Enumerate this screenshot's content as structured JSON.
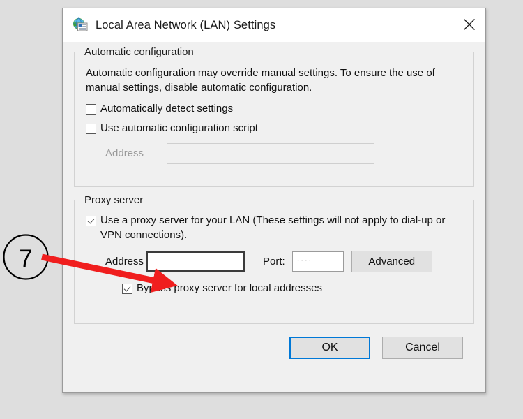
{
  "window": {
    "title": "Local Area Network (LAN) Settings",
    "icon": "globe-settings-icon",
    "close_icon": "close-icon"
  },
  "auto_config": {
    "group_title": "Automatic configuration",
    "description": "Automatic configuration may override manual settings.  To ensure the use of manual settings, disable automatic configuration.",
    "detect_settings": {
      "label": "Automatically detect settings",
      "checked": false
    },
    "use_script": {
      "label": "Use automatic configuration script",
      "checked": false
    },
    "address": {
      "label": "Address",
      "value": "",
      "placeholder": "",
      "disabled": true
    }
  },
  "proxy": {
    "group_title": "Proxy server",
    "use_proxy": {
      "label": "Use a proxy server for your LAN (These settings will not apply to dial-up or VPN connections).",
      "checked": true
    },
    "address": {
      "label": "Address",
      "value": "",
      "placeholder": ""
    },
    "port": {
      "label": "Port:",
      "value": "",
      "placeholder": "...."
    },
    "advanced_button": "Advanced",
    "bypass": {
      "label": "Bypass proxy server for local addresses",
      "checked": true
    }
  },
  "footer": {
    "ok_label": "OK",
    "cancel_label": "Cancel"
  },
  "annotation": {
    "step_number": "7",
    "arrow_color": "#f01e1e",
    "circle_color": "#000000"
  },
  "colors": {
    "accent": "#0078d7",
    "dialog_bg": "#f0f0f0",
    "page_bg": "#dedede",
    "annotation_red": "#f01e1e"
  }
}
